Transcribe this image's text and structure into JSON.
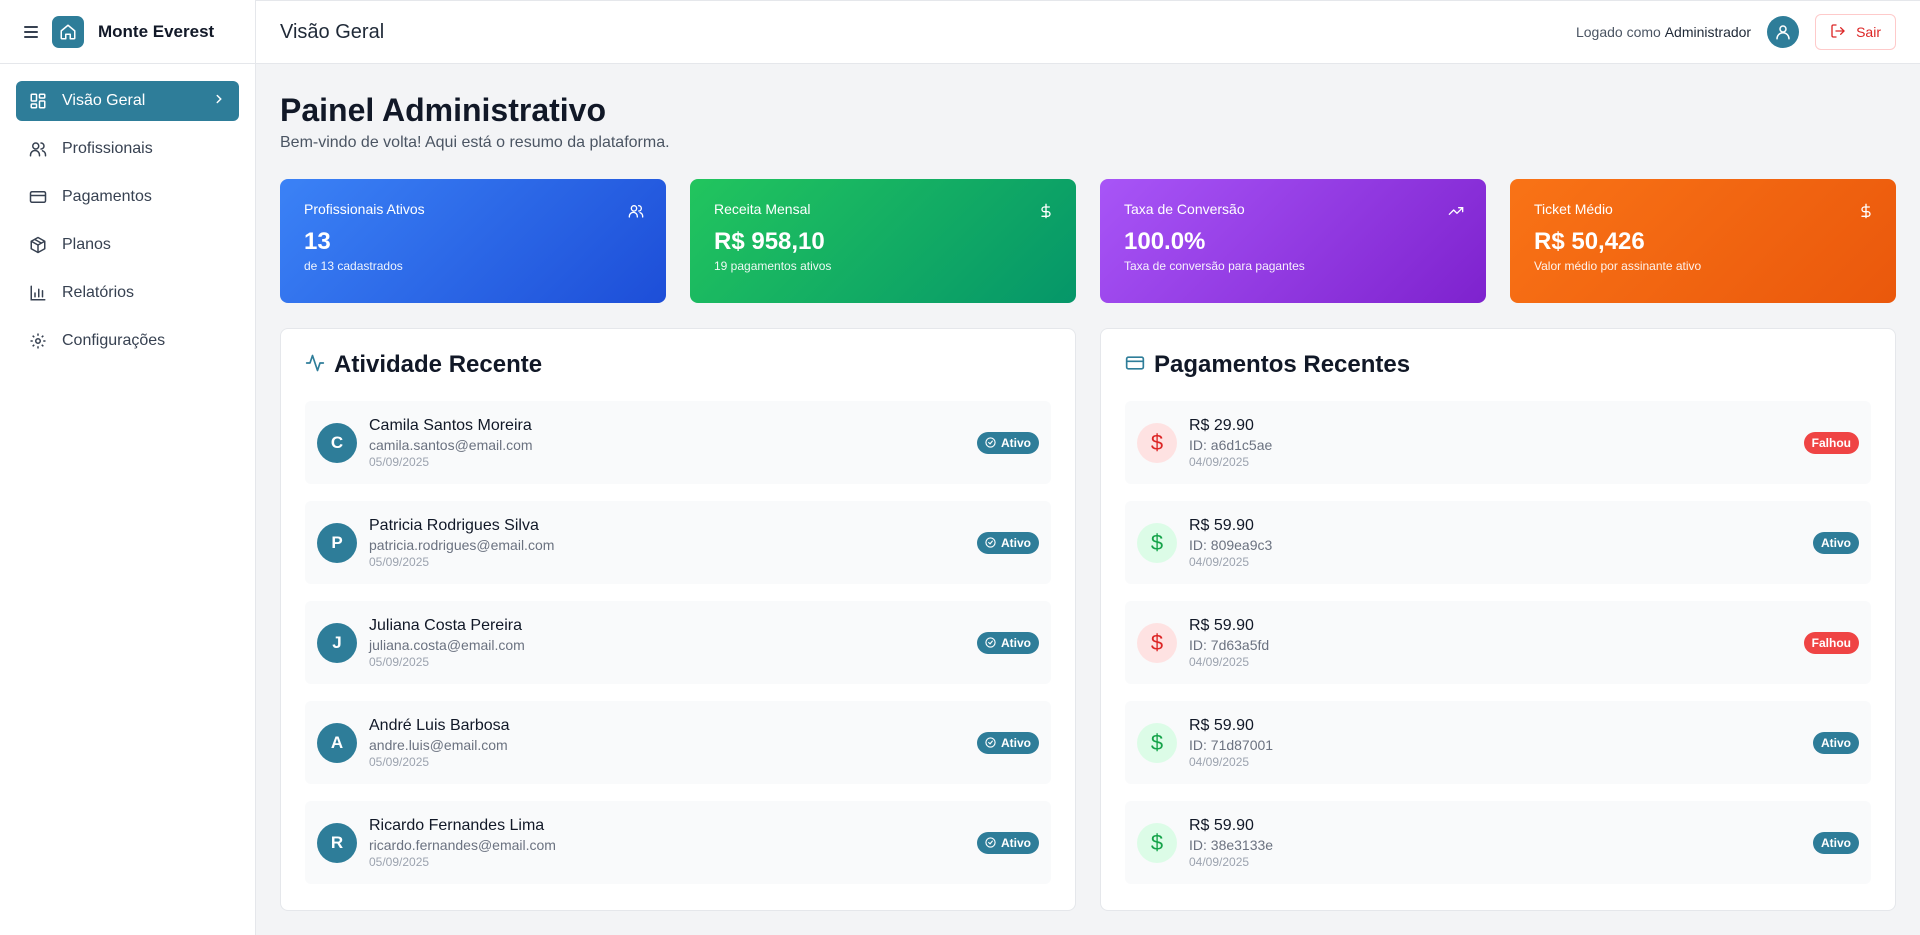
{
  "brand": {
    "name": "Monte Everest"
  },
  "sidebar": {
    "items": [
      {
        "label": "Visão Geral",
        "icon": "dashboard-icon",
        "active": true
      },
      {
        "label": "Profissionais",
        "icon": "users-icon",
        "active": false
      },
      {
        "label": "Pagamentos",
        "icon": "credit-card-icon",
        "active": false
      },
      {
        "label": "Planos",
        "icon": "package-icon",
        "active": false
      },
      {
        "label": "Relatórios",
        "icon": "bar-chart-icon",
        "active": false
      },
      {
        "label": "Configurações",
        "icon": "settings-icon",
        "active": false
      }
    ]
  },
  "header": {
    "title": "Visão Geral",
    "logged_prefix": "Logado como",
    "logged_user": "Administrador",
    "logout_label": "Sair"
  },
  "page": {
    "title": "Painel Administrativo",
    "subtitle": "Bem-vindo de volta! Aqui está o resumo da plataforma."
  },
  "stats": [
    {
      "label": "Profissionais Ativos",
      "value": "13",
      "desc": "de 13 cadastrados",
      "icon": "users-icon",
      "color": "#2563eb"
    },
    {
      "label": "Receita Mensal",
      "value": "R$ 958,10",
      "desc": "19 pagamentos ativos",
      "icon": "dollar-icon",
      "color": "#16a34a"
    },
    {
      "label": "Taxa de Conversão",
      "value": "100.0%",
      "desc": "Taxa de conversão para pagantes",
      "icon": "trending-up-icon",
      "color": "#9333ea"
    },
    {
      "label": "Ticket Médio",
      "value": "R$ 50,426",
      "desc": "Valor médio por assinante ativo",
      "icon": "dollar-icon",
      "color": "#f97316"
    }
  ],
  "activity": {
    "title": "Atividade Recente",
    "items": [
      {
        "initial": "C",
        "name": "Camila Santos Moreira",
        "email": "camila.santos@email.com",
        "date": "05/09/2025",
        "status": "Ativo"
      },
      {
        "initial": "P",
        "name": "Patricia Rodrigues Silva",
        "email": "patricia.rodrigues@email.com",
        "date": "05/09/2025",
        "status": "Ativo"
      },
      {
        "initial": "J",
        "name": "Juliana Costa Pereira",
        "email": "juliana.costa@email.com",
        "date": "05/09/2025",
        "status": "Ativo"
      },
      {
        "initial": "A",
        "name": "André Luis Barbosa",
        "email": "andre.luis@email.com",
        "date": "05/09/2025",
        "status": "Ativo"
      },
      {
        "initial": "R",
        "name": "Ricardo Fernandes Lima",
        "email": "ricardo.fernandes@email.com",
        "date": "05/09/2025",
        "status": "Ativo"
      }
    ]
  },
  "payments": {
    "title": "Pagamentos Recentes",
    "items": [
      {
        "amount": "R$ 29.90",
        "id": "ID: a6d1c5ae",
        "date": "04/09/2025",
        "status": "Falhou"
      },
      {
        "amount": "R$ 59.90",
        "id": "ID: 809ea9c3",
        "date": "04/09/2025",
        "status": "Ativo"
      },
      {
        "amount": "R$ 59.90",
        "id": "ID: 7d63a5fd",
        "date": "04/09/2025",
        "status": "Falhou"
      },
      {
        "amount": "R$ 59.90",
        "id": "ID: 71d87001",
        "date": "04/09/2025",
        "status": "Ativo"
      },
      {
        "amount": "R$ 59.90",
        "id": "ID: 38e3133e",
        "date": "04/09/2025",
        "status": "Ativo"
      }
    ]
  },
  "colors": {
    "accent": "#2e7d99",
    "danger": "#ef4444",
    "success": "#16a34a"
  }
}
